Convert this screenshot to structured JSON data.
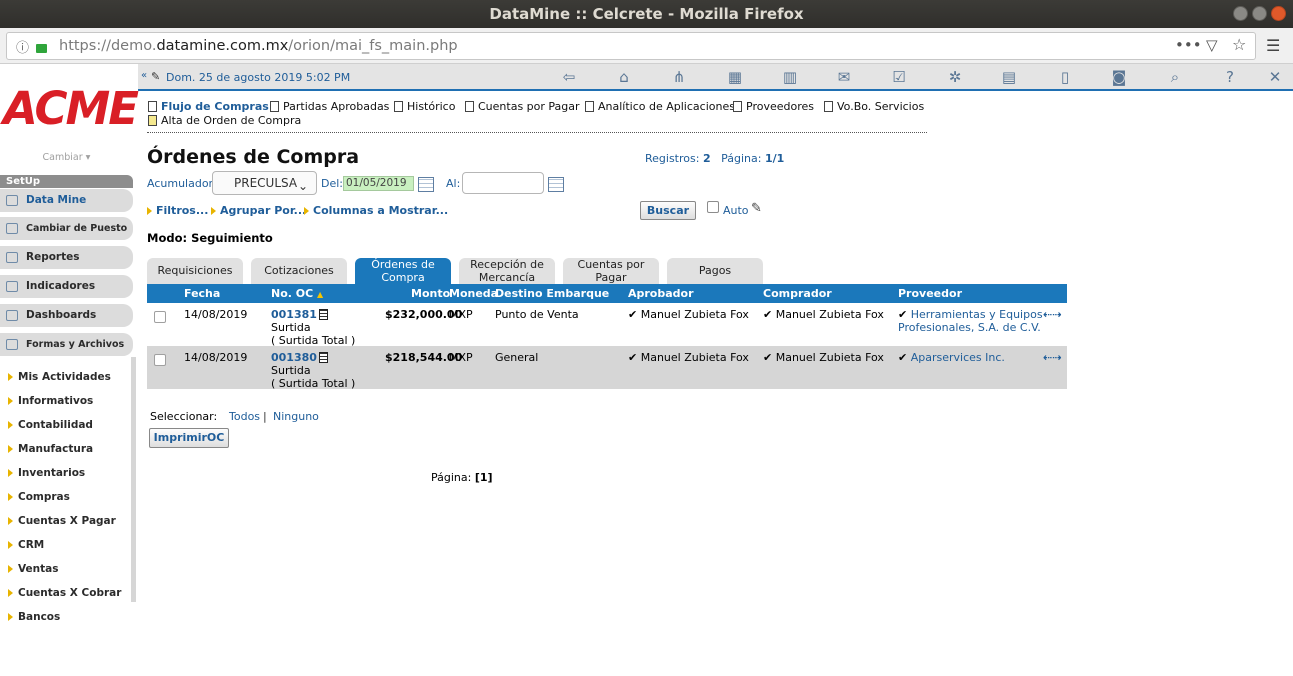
{
  "window": {
    "title": "DataMine :: Celcrete - Mozilla Firefox",
    "url_prefix": "https://demo.",
    "url_domain": "datamine.com.mx",
    "url_path": "/orion/mai_fs_main.php"
  },
  "sidebar": {
    "logo": "ACME",
    "cambiar": "Cambiar",
    "setup_header": "SetUp",
    "buttons": [
      {
        "label": "Data Mine"
      },
      {
        "label": "Cambiar de Puesto"
      },
      {
        "label": "Reportes"
      },
      {
        "label": "Indicadores"
      },
      {
        "label": "Dashboards"
      },
      {
        "label": "Formas y Archivos"
      }
    ],
    "menu": [
      "Mis Actividades",
      "Informativos",
      "Contabilidad",
      "Manufactura",
      "Inventarios",
      "Compras",
      "Cuentas X Pagar",
      "CRM",
      "Ventas",
      "Cuentas X Cobrar",
      "Bancos"
    ]
  },
  "appbar": {
    "datetime": "Dom. 25 de agosto 2019    5:02 PM"
  },
  "subnav": [
    "Flujo de Compras",
    "Partidas Aprobadas",
    "Histórico",
    "Cuentas por Pagar",
    "Analítico de Aplicaciones",
    "Proveedores",
    "Vo.Bo. Servicios",
    "Alta de Orden de Compra"
  ],
  "page": {
    "title": "Órdenes de Compra",
    "registros_label": "Registros:",
    "registros_value": "2",
    "pagina_label": "Página:",
    "pagina_value": "1/1"
  },
  "filters": {
    "acumulador_label": "Acumulador:",
    "acumulador_value": "PRECULSA",
    "del_label": "Del:",
    "del_value": "01/05/2019",
    "al_label": "Al:",
    "al_value": ""
  },
  "actions": {
    "filtros": "Filtros...",
    "agrupar": "Agrupar Por...",
    "columnas": "Columnas a Mostrar...",
    "buscar": "Buscar",
    "auto": "Auto"
  },
  "modo": "Modo: Seguimiento",
  "tabs": [
    {
      "line1": "Requisiciones",
      "line2": ""
    },
    {
      "line1": "Cotizaciones",
      "line2": ""
    },
    {
      "line1": "Órdenes de",
      "line2": "Compra"
    },
    {
      "line1": "Recepción de",
      "line2": "Mercancía"
    },
    {
      "line1": "Cuentas por",
      "line2": "Pagar"
    },
    {
      "line1": "Pagos",
      "line2": ""
    }
  ],
  "table": {
    "headers": [
      "Fecha",
      "No. OC",
      "Monto",
      "Moneda",
      "Destino Embarque",
      "Aprobador",
      "Comprador",
      "Proveedor"
    ],
    "rows": [
      {
        "fecha": "14/08/2019",
        "oc": "001381",
        "status1": "Surtida",
        "status2": "( Surtida Total )",
        "monto": "$232,000.00",
        "moneda": "MXP",
        "destino": "Punto de Venta",
        "aprobador": "Manuel Zubieta Fox",
        "comprador": "Manuel Zubieta Fox",
        "proveedor1": "Herramientas y Equipos",
        "proveedor2": "Profesionales, S.A. de C.V."
      },
      {
        "fecha": "14/08/2019",
        "oc": "001380",
        "status1": "Surtida",
        "status2": "( Surtida Total )",
        "monto": "$218,544.00",
        "moneda": "MXP",
        "destino": "General",
        "aprobador": "Manuel Zubieta Fox",
        "comprador": "Manuel Zubieta Fox",
        "proveedor1": "Aparservices Inc.",
        "proveedor2": ""
      }
    ]
  },
  "footer": {
    "seleccionar": "Seleccionar:",
    "todos": "Todos",
    "sep": "|",
    "ninguno": "Ninguno",
    "imprimir": "ImprimirOC",
    "pagina_label": "Página:",
    "pagina_value": "[1]"
  }
}
